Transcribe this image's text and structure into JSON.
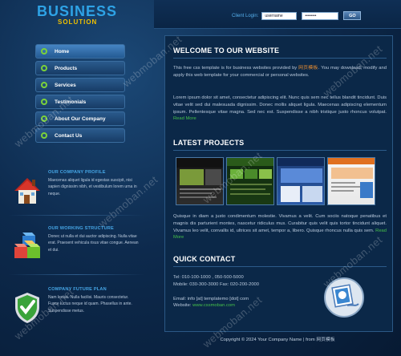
{
  "logo": {
    "main": "BUSINESS",
    "sub": "SOLUTION"
  },
  "nav": [
    {
      "label": "Home",
      "active": true
    },
    {
      "label": "Products"
    },
    {
      "label": "Services"
    },
    {
      "label": "Testimonials"
    },
    {
      "label": "About Our Company"
    },
    {
      "label": "Contact Us"
    }
  ],
  "sidebar": [
    {
      "title": "OUR COMPANY PROFILE",
      "body": "Maecenas aliquet ligula id egestas suscipit, nisi sapien dignissim nibh, et vestibulum lorem urna in neque.",
      "icon": "house-icon"
    },
    {
      "title": "OUR WORKING STRUCTURE",
      "body": "Donec ut nulla et dui auctor adipiscing. Nulla vitae erat. Praesent vehicula risus vitae congue. Aenean et dui.",
      "icon": "cubes-icon"
    },
    {
      "title": "COMPANY FUTURE PLAN",
      "body": "Nam lectus. Nulla facilisi. Mauris consectetur. Fusce luctus neque id quam. Phasellus in ante. Suspendisse metus.",
      "icon": "shield-check-icon"
    }
  ],
  "login": {
    "label": "Client Login:",
    "username_value": "username",
    "password_value": "••••••••",
    "go_label": "GO"
  },
  "welcome": {
    "title": "WELCOME TO OUR WEBSITE",
    "para1_a": "This free css template is for business websites provided by ",
    "para1_brand": "网页模板",
    "para1_b": ". You may download, modify and apply this web template for your commercial or personal websites.",
    "para2": "Lorem ipsum dolor sit amet, consectetur adipiscing elit. Nunc quis sem nec tellus blandit tincidunt. Duis vitae velit sed dui malesuada dignissim. Donec mollis aliquet ligula. Maecenas adipiscing elementum ipsum. Pellentesque vitae magna. Sed nec est. Suspendisse a nibh tristique justo rhoncus volutpat.",
    "read_more": "Read More"
  },
  "projects": {
    "title": "LATEST PROJECTS",
    "para": "Quisque in diam a justo condimentum molestie. Vivamus a velit. Cum sociis natoque penatibus et magnis dis parturient montes, nascetur ridiculus mus. Curabitur quis velit quis tortor tincidunt aliquet. Vivamus leo velit, convallis id, ultrices sit amet, tempor a, libero. Quisque rhoncus nulla quis sem.",
    "read_more": "Read More"
  },
  "contact": {
    "title": "QUICK CONTACT",
    "tel": "Tel: 010-100-1000 , 050-500-5000",
    "mobile": "Mobile: 030-300-3000 Fax: 020-200-2000",
    "email": "Email: info [at] templatemo [dot] com",
    "website_label": "Website: ",
    "website": "www.cssmoban.com"
  },
  "footer": {
    "text": "Copyright © 2024 Your Company Name | from 网页模板"
  },
  "watermark": "webmoban.net",
  "colors": {
    "accent": "#2ea3e6",
    "link": "#45c04a",
    "nav_dot": "#7bd13a",
    "logo_sub": "#f0c000"
  }
}
